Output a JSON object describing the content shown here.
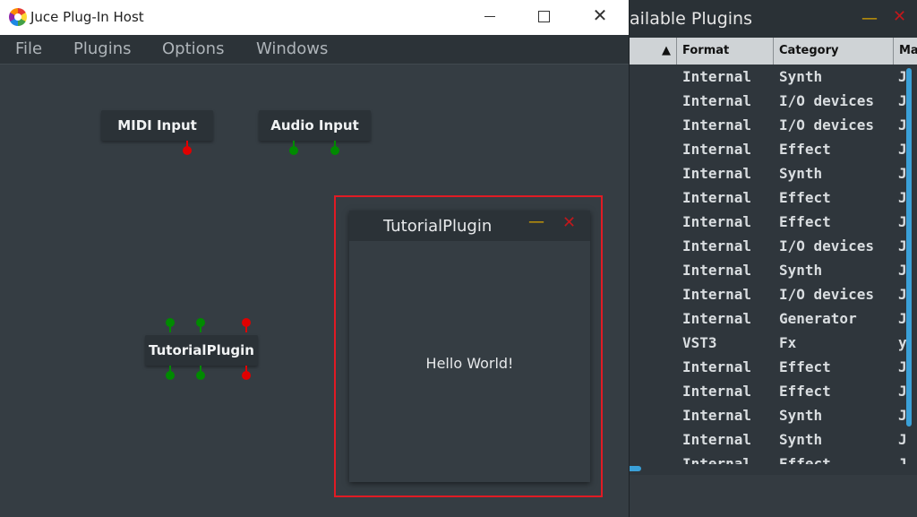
{
  "plugins_window": {
    "title": "ailable Plugins",
    "min_glyph": "—",
    "close_glyph": "✕",
    "headers": {
      "sort_arrow": "▲",
      "format": "Format",
      "category": "Category",
      "manufacturer": "Ma"
    },
    "rows": [
      {
        "format": "Internal",
        "category": "Synth",
        "manufacturer": "J"
      },
      {
        "format": "Internal",
        "category": "I/O devices",
        "manufacturer": "J"
      },
      {
        "format": "Internal",
        "category": "I/O devices",
        "manufacturer": "J"
      },
      {
        "format": "Internal",
        "category": "Effect",
        "manufacturer": "J"
      },
      {
        "format": "Internal",
        "category": "Synth",
        "manufacturer": "J"
      },
      {
        "format": "Internal",
        "category": "Effect",
        "manufacturer": "J"
      },
      {
        "format": "Internal",
        "category": "Effect",
        "manufacturer": "J"
      },
      {
        "format": "Internal",
        "category": "I/O devices",
        "manufacturer": "J"
      },
      {
        "format": "Internal",
        "category": "Synth",
        "manufacturer": "J"
      },
      {
        "format": "Internal",
        "category": "I/O devices",
        "manufacturer": "J"
      },
      {
        "format": "Internal",
        "category": "Generator",
        "manufacturer": "J"
      },
      {
        "format": "VST3",
        "category": "Fx",
        "manufacturer": "y"
      },
      {
        "format": "Internal",
        "category": "Effect",
        "manufacturer": "J"
      },
      {
        "format": "Internal",
        "category": "Effect",
        "manufacturer": "J"
      },
      {
        "format": "Internal",
        "category": "Synth",
        "manufacturer": "J"
      },
      {
        "format": "Internal",
        "category": "Synth",
        "manufacturer": "J"
      },
      {
        "format": "Internal",
        "category": "Effect",
        "manufacturer": "J"
      }
    ]
  },
  "host": {
    "title": "Juce Plug-In Host",
    "close_glyph": "✕",
    "menu": [
      "File",
      "Plugins",
      "Options",
      "Windows"
    ]
  },
  "graph": {
    "midi_input": "MIDI Input",
    "audio_input": "Audio Input",
    "tutorial_plugin": "TutorialPlugin"
  },
  "editor": {
    "title": "TutorialPlugin",
    "min_glyph": "—",
    "close_glyph": "✕",
    "content": "Hello World!"
  },
  "colors": {
    "accent_red": "#e01b24",
    "pin_green": "#008a00",
    "pin_red": "#e00000",
    "scroll_blue": "#3aa0d8"
  }
}
